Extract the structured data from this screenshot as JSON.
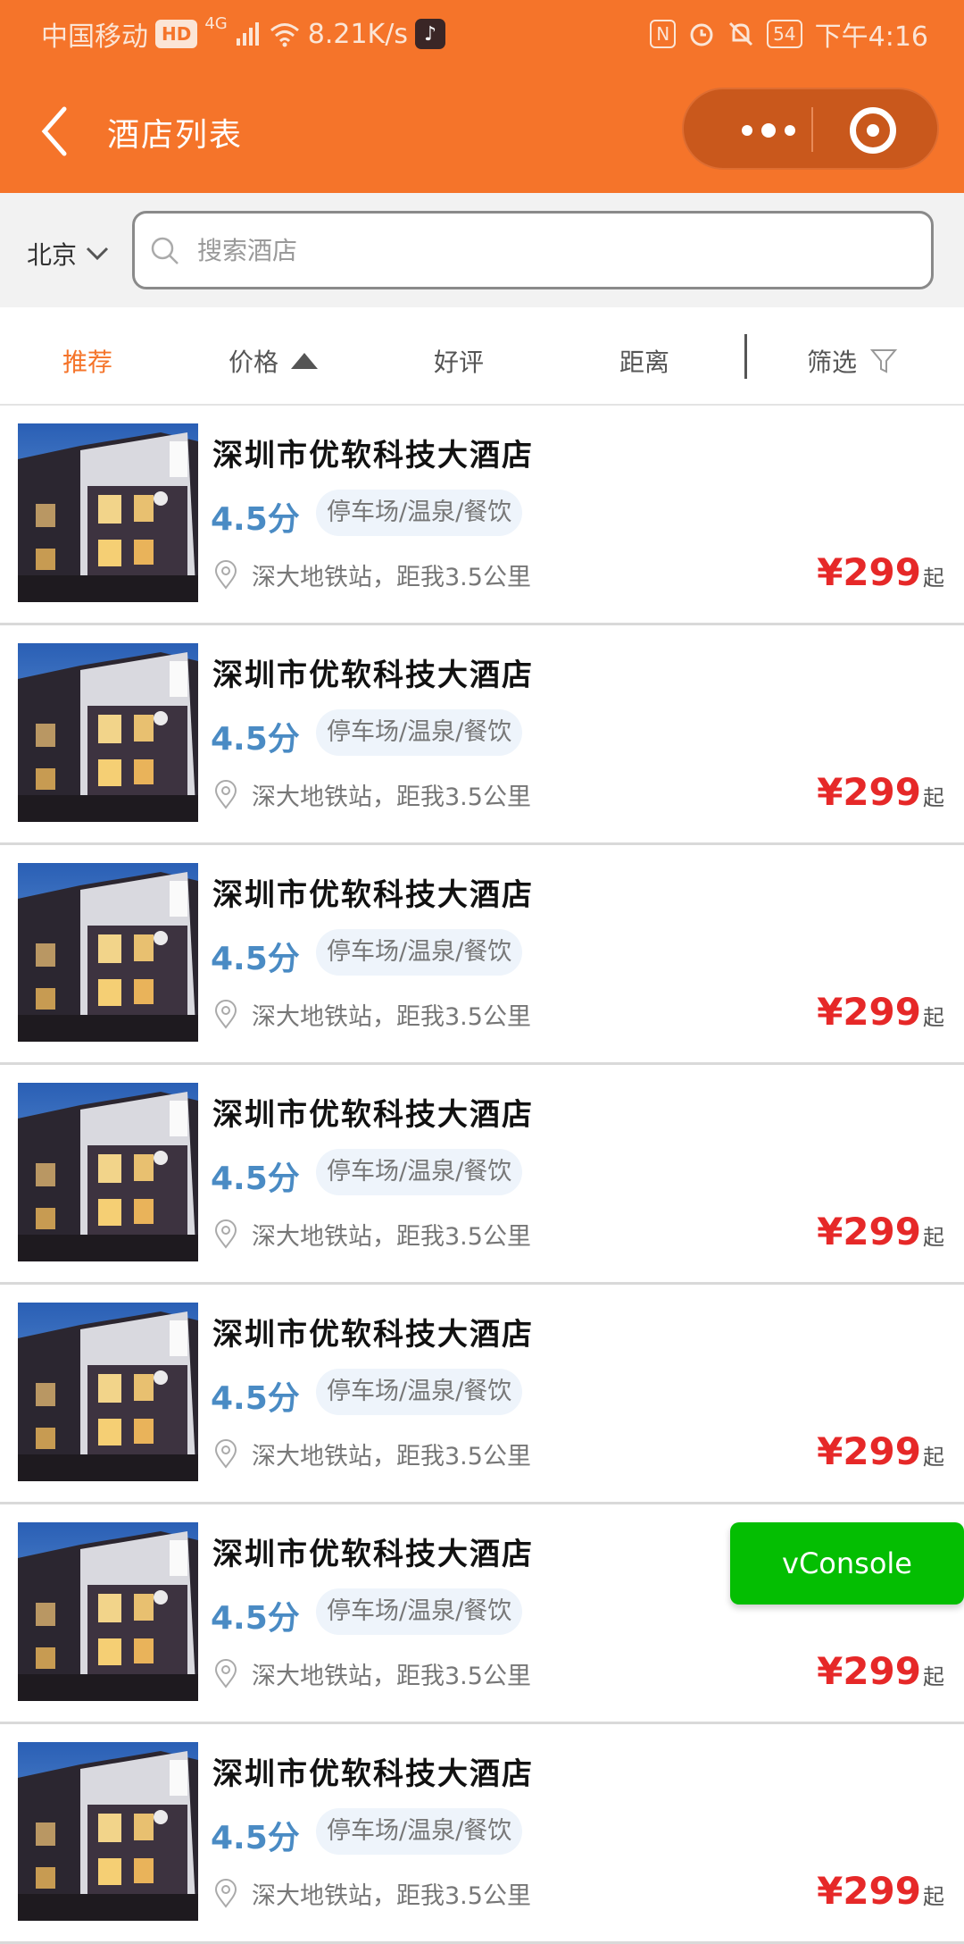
{
  "status_bar": {
    "carrier": "中国移动",
    "hd_badge": "HD",
    "network": "4G",
    "speed": "8.21K/s",
    "battery": "54",
    "time": "下午4:16"
  },
  "navbar": {
    "title": "酒店列表",
    "background_color": "#f5742a"
  },
  "search": {
    "city": "北京",
    "placeholder": "搜索酒店"
  },
  "sort_tabs": {
    "recommend": "推荐",
    "price": "价格",
    "rating": "好评",
    "distance": "距离",
    "filter": "筛选",
    "active": "推荐",
    "accent_color": "#f5742a"
  },
  "hotels": [
    {
      "name": "深圳市优软科技大酒店",
      "score": "4.5分",
      "tags": "停车场/温泉/餐饮",
      "location": "深大地铁站，距我3.5公里",
      "price": "¥299",
      "price_suffix": "起"
    },
    {
      "name": "深圳市优软科技大酒店",
      "score": "4.5分",
      "tags": "停车场/温泉/餐饮",
      "location": "深大地铁站，距我3.5公里",
      "price": "¥299",
      "price_suffix": "起"
    },
    {
      "name": "深圳市优软科技大酒店",
      "score": "4.5分",
      "tags": "停车场/温泉/餐饮",
      "location": "深大地铁站，距我3.5公里",
      "price": "¥299",
      "price_suffix": "起"
    },
    {
      "name": "深圳市优软科技大酒店",
      "score": "4.5分",
      "tags": "停车场/温泉/餐饮",
      "location": "深大地铁站，距我3.5公里",
      "price": "¥299",
      "price_suffix": "起"
    },
    {
      "name": "深圳市优软科技大酒店",
      "score": "4.5分",
      "tags": "停车场/温泉/餐饮",
      "location": "深大地铁站，距我3.5公里",
      "price": "¥299",
      "price_suffix": "起"
    },
    {
      "name": "深圳市优软科技大酒店",
      "score": "4.5分",
      "tags": "停车场/温泉/餐饮",
      "location": "深大地铁站，距我3.5公里",
      "price": "¥299",
      "price_suffix": "起"
    },
    {
      "name": "深圳市优软科技大酒店",
      "score": "4.5分",
      "tags": "停车场/温泉/餐饮",
      "location": "深大地铁站，距我3.5公里",
      "price": "¥299",
      "price_suffix": "起"
    }
  ],
  "vconsole": {
    "label": "vConsole",
    "color": "#04be02"
  }
}
